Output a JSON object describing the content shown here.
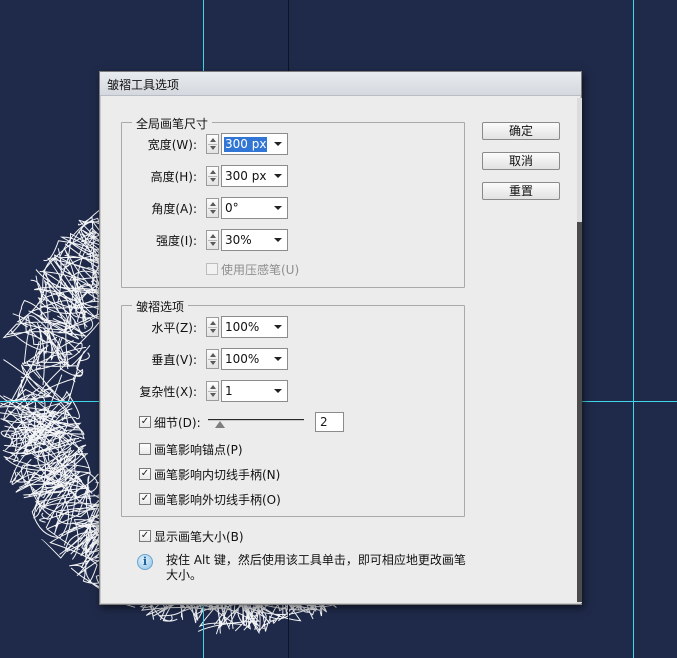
{
  "dialog": {
    "title": "皱褶工具选项",
    "buttons": {
      "ok": "确定",
      "cancel": "取消",
      "reset": "重置"
    }
  },
  "global_brush": {
    "title": "全局画笔尺寸",
    "width": {
      "label": "宽度(W):",
      "value": "300 px"
    },
    "height": {
      "label": "高度(H):",
      "value": "300 px"
    },
    "angle": {
      "label": "角度(A):",
      "value": "0°"
    },
    "intensity": {
      "label": "强度(I):",
      "value": "30%"
    },
    "use_pressure_pen": {
      "label": "使用压感笔(U)",
      "checked": false,
      "enabled": false
    }
  },
  "crinkle_options": {
    "title": "皱褶选项",
    "horizontal": {
      "label": "水平(Z):",
      "value": "100%"
    },
    "vertical": {
      "label": "垂直(V):",
      "value": "100%"
    },
    "complexity": {
      "label": "复杂性(X):",
      "value": "1"
    },
    "detail": {
      "label": "细节(D):",
      "checked": true,
      "value": "2",
      "slider_fraction": 0.12
    },
    "brush_affects_anchor": {
      "label": "画笔影响锚点(P)",
      "checked": false
    },
    "brush_affects_in_tangent": {
      "label": "画笔影响内切线手柄(N)",
      "checked": true
    },
    "brush_affects_out_tangent": {
      "label": "画笔影响外切线手柄(O)",
      "checked": true
    }
  },
  "show_brush_size": {
    "label": "显示画笔大小(B)",
    "checked": true
  },
  "info": {
    "icon": "info-icon",
    "icon_glyph": "i",
    "line1": "按住 Alt 键，然后使用该工具单击，即可相应地更改画笔",
    "line2": "大小。"
  },
  "check_glyph": "✓",
  "colors": {
    "canvas_bg": "#1f2a4a",
    "guide": "#3fd6e8",
    "selection": "#3176d4"
  }
}
